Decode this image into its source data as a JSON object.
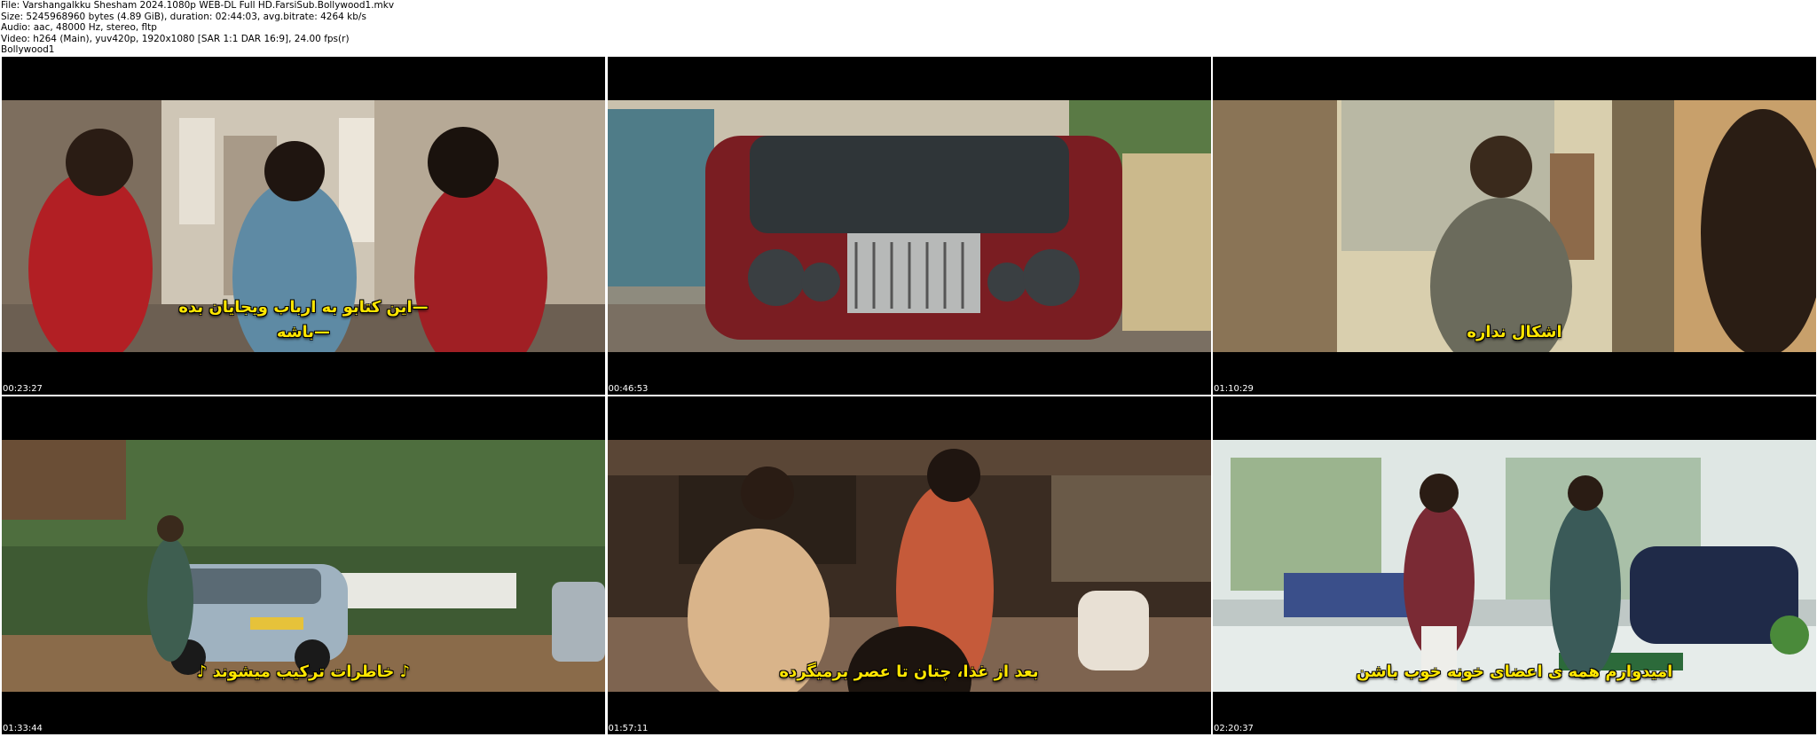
{
  "header": {
    "file": "File: Varshangalkku Shesham 2024.1080p WEB-DL Full HD.FarsiSub.Bollywood1.mkv",
    "size": "Size: 5245968960 bytes (4.89 GiB), duration: 02:44:03, avg.bitrate: 4264 kb/s",
    "audio": "Audio: aac, 48000 Hz, stereo, fltp",
    "video": "Video: h264 (Main), yuv420p, 1920x1080 [SAR 1:1 DAR 16:9], 24.00 fps(r)",
    "tag": "Bollywood1"
  },
  "thumbnails": [
    {
      "timestamp": "00:23:27",
      "subtitle": [
        "—این کتابو به ارباب ویجایان بده",
        "—باشه"
      ],
      "palette": {
        "bg": "#8a7a6a",
        "wall": "#cfc6b6",
        "accent": "#b21f24"
      }
    },
    {
      "timestamp": "00:46:53",
      "subtitle": [],
      "palette": {
        "bg": "#6f7a6b",
        "wall": "#b8b4a6",
        "accent": "#7a1d22"
      }
    },
    {
      "timestamp": "01:10:29",
      "subtitle": [
        "اشکال نداره"
      ],
      "palette": {
        "bg": "#5a4a36",
        "wall": "#d9cfae",
        "accent": "#6b6b5c"
      }
    },
    {
      "timestamp": "01:33:44",
      "subtitle": [
        "♪ خاطرات ترکیب میشوند ♪"
      ],
      "palette": {
        "bg": "#3e5a33",
        "wall": "#7a6a4f",
        "accent": "#9fb2c0"
      }
    },
    {
      "timestamp": "01:57:11",
      "subtitle": [
        "بعد از غذا، چتان تا عصر برمیگرده"
      ],
      "palette": {
        "bg": "#3a2c22",
        "wall": "#7e6450",
        "accent": "#c55a3a"
      }
    },
    {
      "timestamp": "02:20:37",
      "subtitle": [
        "امیدوارم همه ی اعضای خونه خوب باشن"
      ],
      "palette": {
        "bg": "#bfc8c6",
        "wall": "#e6ecea",
        "accent": "#7a2a34"
      }
    }
  ]
}
